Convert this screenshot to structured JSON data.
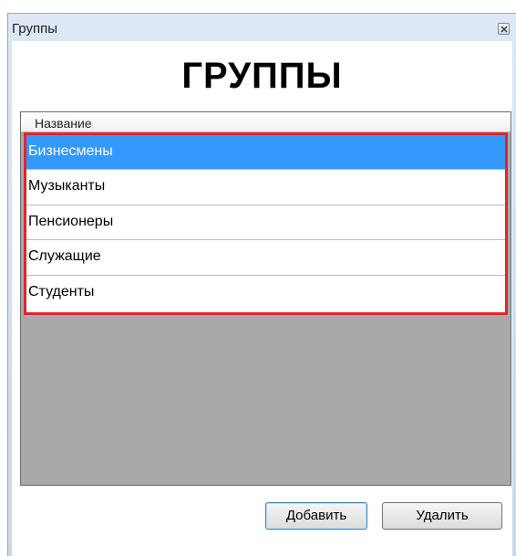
{
  "window": {
    "title": "Группы"
  },
  "header": {
    "big_title": "ГРУППЫ"
  },
  "grid": {
    "column_header": "Название",
    "rows": [
      {
        "label": "Бизнесмены",
        "selected": true
      },
      {
        "label": "Музыканты",
        "selected": false
      },
      {
        "label": "Пенсионеры",
        "selected": false
      },
      {
        "label": "Служащие",
        "selected": false
      },
      {
        "label": "Студенты",
        "selected": false
      }
    ],
    "highlight_color": "#e0242d",
    "selection_color": "#3399ff",
    "empty_area_color": "#a9a9a9"
  },
  "buttons": {
    "add_label": "Добавить",
    "delete_label": "Удалить"
  },
  "icons": {
    "close": "close-icon"
  }
}
